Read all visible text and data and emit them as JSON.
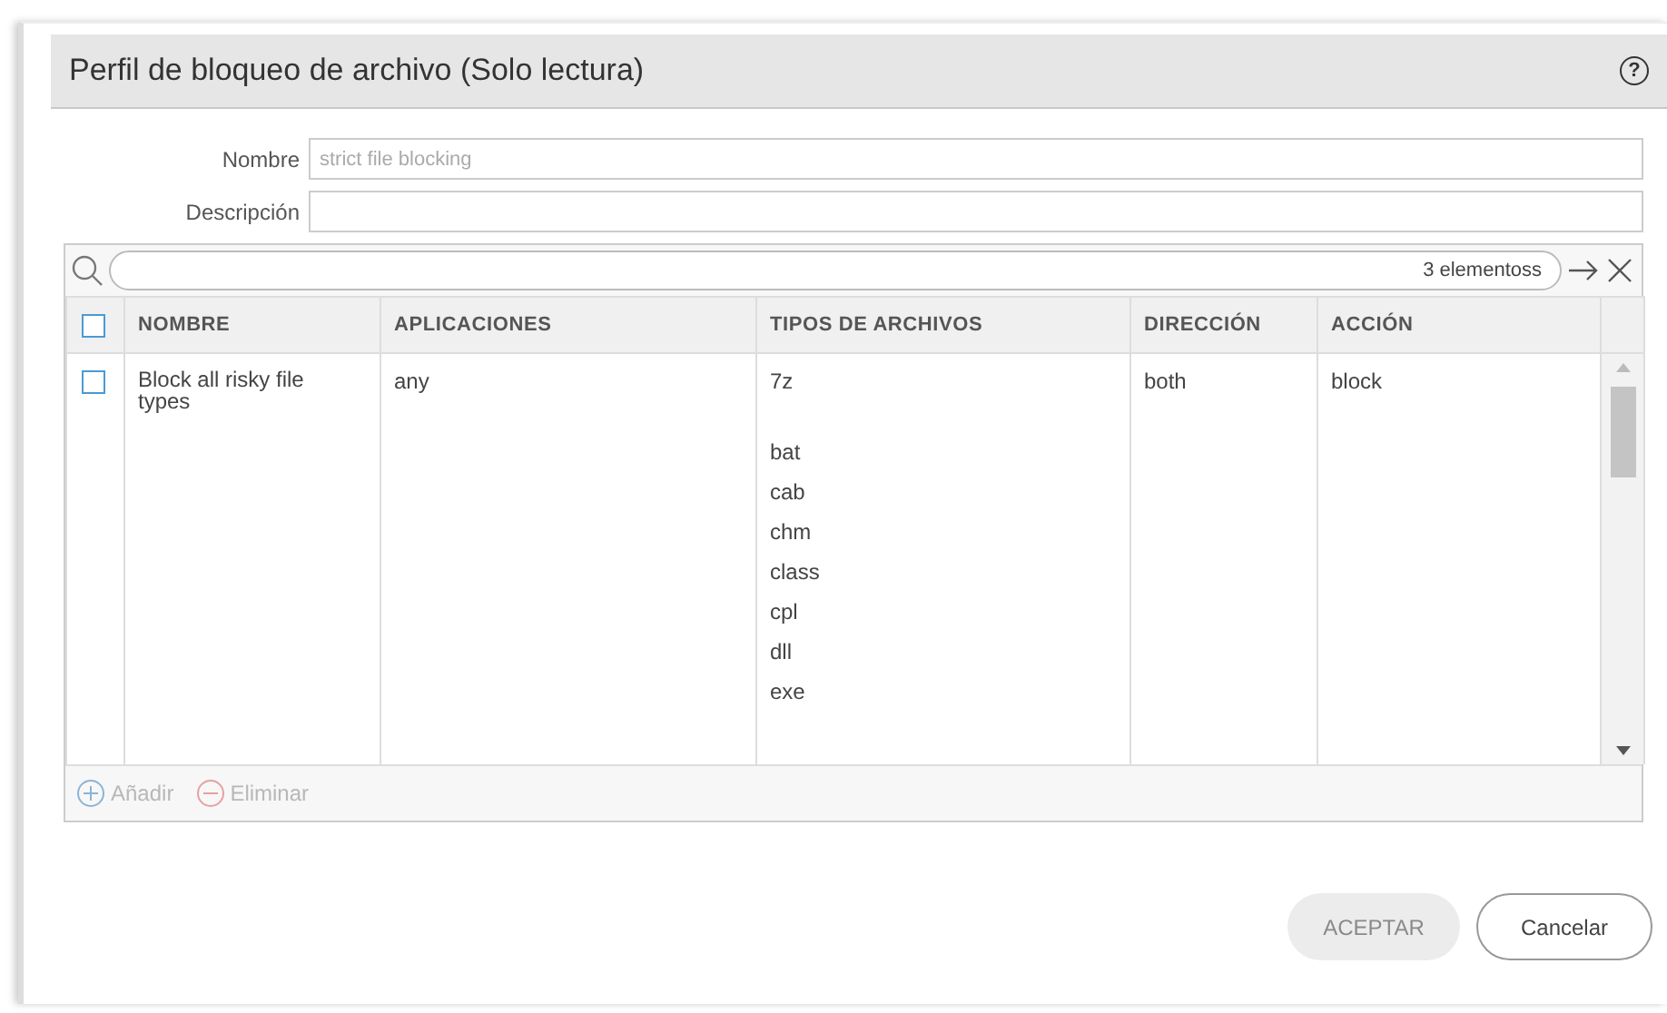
{
  "dialog": {
    "title": "Perfil de bloqueo de archivo (Solo lectura)",
    "help": "?"
  },
  "fields": [
    {
      "label": "Nombre",
      "placeholder": "strict file blocking"
    },
    {
      "label": "Descripción"
    }
  ],
  "search": {
    "count": "3 elementoss"
  },
  "table": {
    "header_checked": false,
    "columns": [
      "NOMBRE",
      "APLICACIONES",
      "TIPOS DE ARCHIVOS",
      "DIRECCIÓN",
      "ACCIÓN"
    ],
    "rows": [
      {
        "checked": false,
        "name": "Block all risky file types",
        "applications": "any",
        "file_types": [
          "7z",
          "bat",
          "cab",
          "chm",
          "class",
          "cpl",
          "dll",
          "exe"
        ],
        "direction": "both",
        "action": "block"
      }
    ]
  },
  "footer_actions": [
    {
      "label": "Añadir",
      "kind": "add",
      "disabled": true
    },
    {
      "label": "Eliminar",
      "kind": "remove",
      "disabled": true
    }
  ],
  "buttons": [
    {
      "label": "ACEPTAR",
      "kind": "primary",
      "disabled": true
    },
    {
      "label": "Cancelar",
      "kind": "secondary",
      "disabled": false
    }
  ]
}
